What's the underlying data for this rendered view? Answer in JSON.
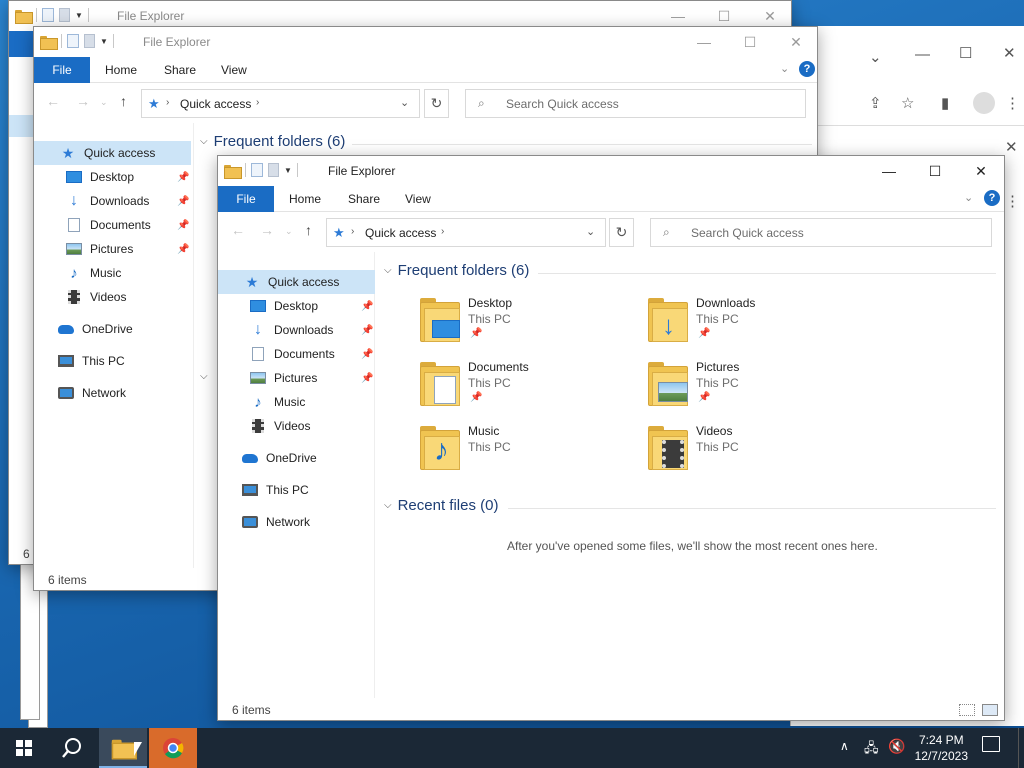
{
  "explorer_title": "File Explorer",
  "ribbon": {
    "file": "File",
    "home": "Home",
    "share": "Share",
    "view": "View",
    "help": "?"
  },
  "address": {
    "location": "Quick access"
  },
  "search": {
    "placeholder": "Search Quick access"
  },
  "nav": {
    "quick_access": "Quick access",
    "pinned": [
      "Desktop",
      "Downloads",
      "Documents",
      "Pictures"
    ],
    "unpinned": [
      "Music",
      "Videos"
    ],
    "onedrive": "OneDrive",
    "this_pc": "This PC",
    "network": "Network"
  },
  "content": {
    "frequent_header": "Frequent folders (6)",
    "recent_header": "Recent files (0)",
    "empty_message": "After you've opened some files, we'll show the most recent ones here.",
    "folders": [
      {
        "name": "Desktop",
        "location": "This PC",
        "pinned": true,
        "icon": "desktop-icon"
      },
      {
        "name": "Downloads",
        "location": "This PC",
        "pinned": true,
        "icon": "download-arrow-icon"
      },
      {
        "name": "Documents",
        "location": "This PC",
        "pinned": true,
        "icon": "document-icon"
      },
      {
        "name": "Pictures",
        "location": "This PC",
        "pinned": true,
        "icon": "picture-icon"
      },
      {
        "name": "Music",
        "location": "This PC",
        "pinned": false,
        "icon": "music-note-icon"
      },
      {
        "name": "Videos",
        "location": "This PC",
        "pinned": false,
        "icon": "film-icon"
      }
    ]
  },
  "status": {
    "items": "6 items",
    "items_partial": "6 i"
  },
  "back_window": {
    "partial_letter": "F"
  },
  "taskbar": {
    "time": "7:24 PM",
    "date": "12/7/2023"
  },
  "colors": {
    "accent": "#1a6cc4",
    "selection": "#cce4f7",
    "taskbar": "#1b2836",
    "header_text": "#1e3e74"
  }
}
